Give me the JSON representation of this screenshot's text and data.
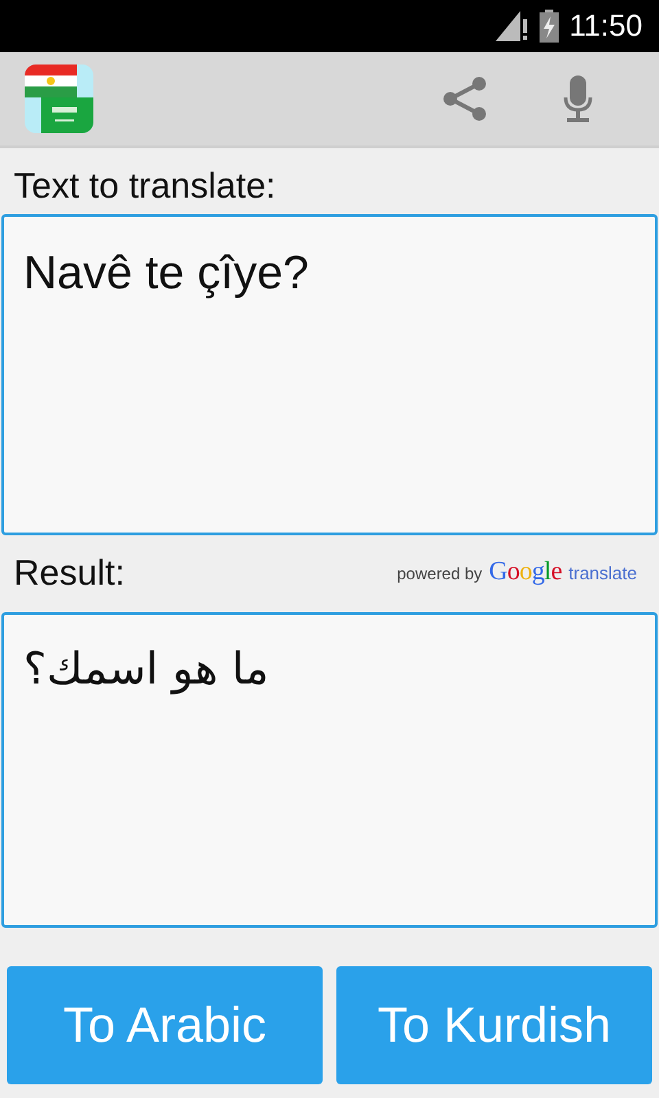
{
  "status_bar": {
    "time": "11:50"
  },
  "toolbar": {
    "actions": [
      {
        "kind": "share"
      },
      {
        "kind": "microphone"
      }
    ]
  },
  "source": {
    "label": "Text to translate:",
    "value": "Navê te çîye?"
  },
  "result": {
    "label": "Result:",
    "text": "ما هو اسمك؟"
  },
  "attribution": {
    "prefix": "powered by",
    "brand": "Google",
    "suffix": "translate"
  },
  "buttons": [
    "To Arabic",
    "To Kurdish"
  ]
}
